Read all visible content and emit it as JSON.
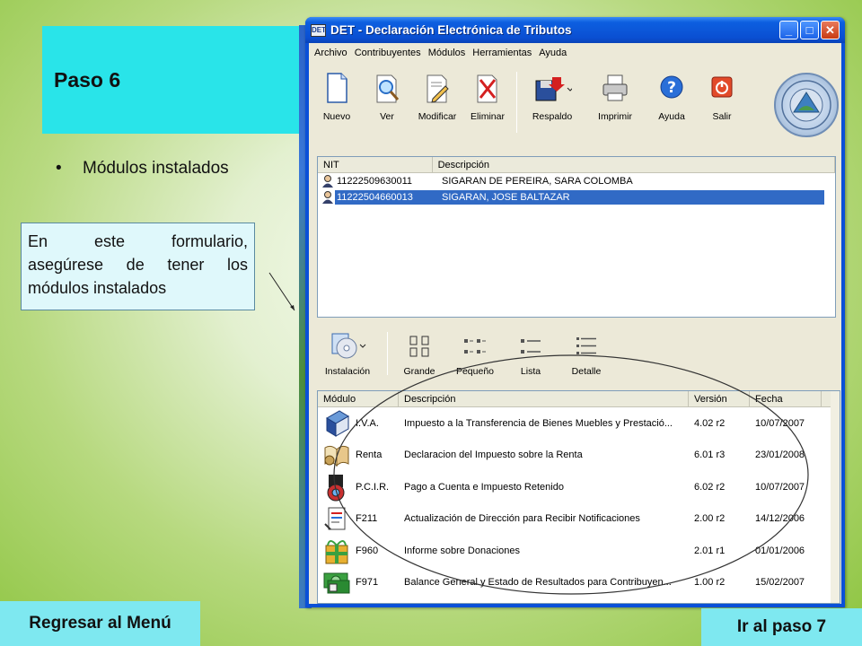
{
  "slide": {
    "title": "Paso 6",
    "bullet": "Módulos instalados",
    "callout_lines": [
      "En este formulario,",
      "asegúrese de tener los",
      "módulos  instalados"
    ],
    "back_button": "Regresar al Menú",
    "next_button": "Ir al paso 7"
  },
  "window": {
    "icon_text": "DET",
    "title": "DET - Declaración Electrónica de Tributos",
    "menu": [
      "Archivo",
      "Contribuyentes",
      "Módulos",
      "Herramientas",
      "Ayuda"
    ],
    "toolbar": [
      "Nuevo",
      "Ver",
      "Modificar",
      "Eliminar",
      "Respaldo",
      "Imprimir",
      "Ayuda",
      "Salir"
    ],
    "contributors": {
      "headers": [
        "NIT",
        "Descripción"
      ],
      "rows": [
        {
          "nit": "11222509630011",
          "desc": "SIGARAN DE PEREIRA, SARA COLOMBA"
        },
        {
          "nit": "11222504660013",
          "desc": "SIGARAN, JOSE BALTAZAR"
        }
      ]
    },
    "module_toolbar": [
      "Instalación",
      "Grande",
      "Pequeño",
      "Lista",
      "Detalle"
    ],
    "modules": {
      "headers": [
        "Módulo",
        "Descripción",
        "Versión",
        "Fecha"
      ],
      "rows": [
        {
          "mod": "I.V.A.",
          "desc": "Impuesto a la Transferencia de Bienes Muebles y Prestació...",
          "ver": "4.02 r2",
          "date": "10/07/2007"
        },
        {
          "mod": "Renta",
          "desc": "Declaracion del Impuesto sobre la Renta",
          "ver": "6.01 r3",
          "date": "23/01/2008"
        },
        {
          "mod": "P.C.I.R.",
          "desc": "Pago a Cuenta e Impuesto Retenido",
          "ver": "6.02 r2",
          "date": "10/07/2007"
        },
        {
          "mod": "F211",
          "desc": "Actualización de Dirección para Recibir Notificaciones",
          "ver": "2.00 r2",
          "date": "14/12/2006"
        },
        {
          "mod": "F960",
          "desc": "Informe sobre Donaciones",
          "ver": "2.01 r1",
          "date": "01/01/2006"
        },
        {
          "mod": "F971",
          "desc": "Balance General y Estado de Resultados para Contribuyen...",
          "ver": "1.00 r2",
          "date": "15/02/2007"
        }
      ]
    }
  }
}
